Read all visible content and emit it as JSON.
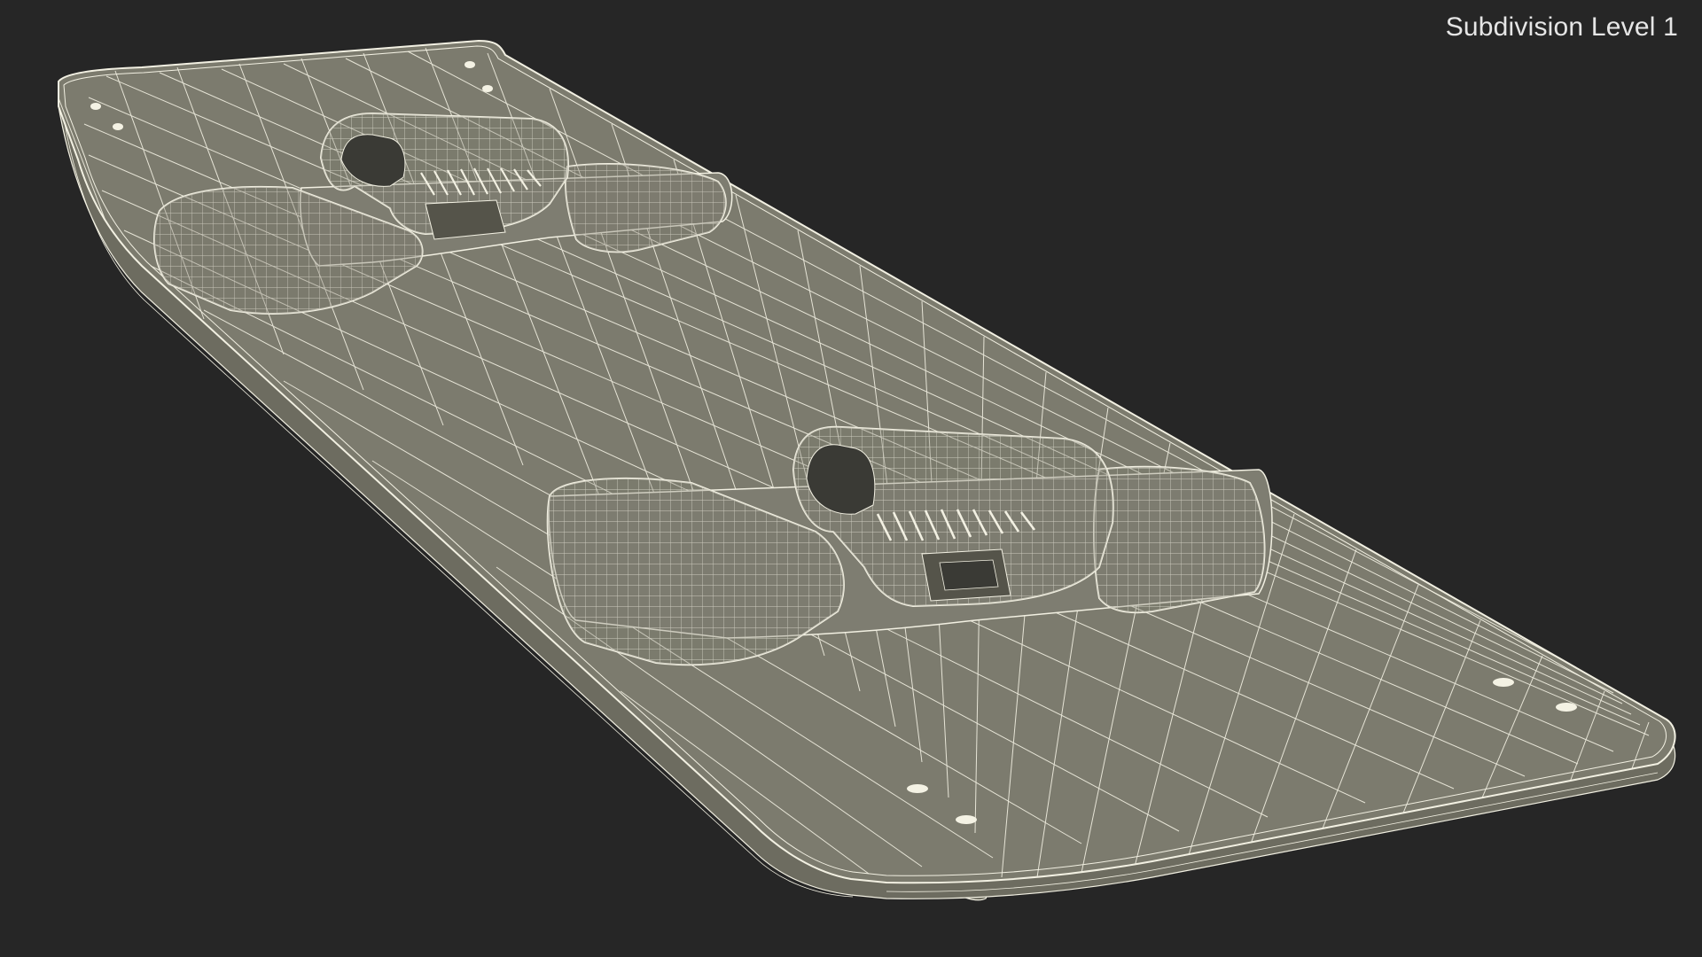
{
  "overlay": {
    "subdivision_label": "Subdivision Level 1"
  },
  "colors": {
    "background": "#262626",
    "surface": "#7c7b6e",
    "wire": "#f2f0e2",
    "label": "#e6e6e6"
  }
}
